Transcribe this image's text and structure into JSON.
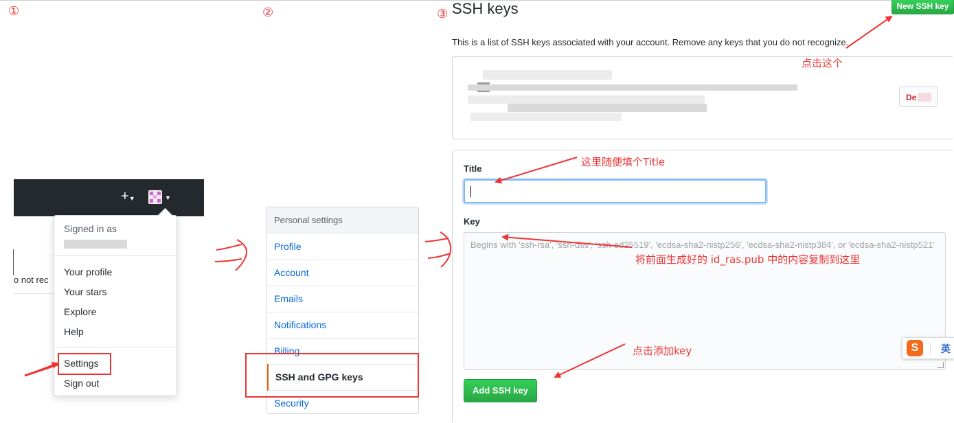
{
  "markers": {
    "step1": "①",
    "step2": "②",
    "step3": "③"
  },
  "panel1": {
    "plus": "+",
    "dropdown": {
      "signed_in_as": "Signed in as",
      "items": [
        "Your profile",
        "Your stars",
        "Explore",
        "Help"
      ],
      "settings": "Settings",
      "sign_out": "Sign out"
    },
    "fragment_text": "o not rec"
  },
  "panel2": {
    "heading": "Personal settings",
    "items": [
      "Profile",
      "Account",
      "Emails",
      "Notifications",
      "Billing"
    ],
    "active": "SSH and GPG keys",
    "after": "Security"
  },
  "panel3": {
    "title": "SSH keys",
    "new_button": "New SSH key",
    "description": "This is a list of SSH keys associated with your account. Remove any keys that you do not recognize.",
    "delete_button": "De",
    "form": {
      "title_label": "Title",
      "title_value": "",
      "key_label": "Key",
      "key_placeholder": "Begins with 'ssh-rsa', 'ssh-dss', 'ssh-ed25519', 'ecdsa-sha2-nistp256', 'ecdsa-sha2-nistp384', or 'ecdsa-sha2-nistp521'",
      "submit": "Add SSH key"
    },
    "ime_label": "英"
  },
  "annotations": {
    "click_this": "点击这个",
    "fill_title": "这里随便填个Title",
    "copy_key": "将前面生成好的 id_ras.pub 中的内容复制到这里",
    "click_add": "点击添加key"
  },
  "colors": {
    "annotation": "#ee3333",
    "link": "#0366d6",
    "header": "#24292e",
    "green": "#28a745"
  }
}
